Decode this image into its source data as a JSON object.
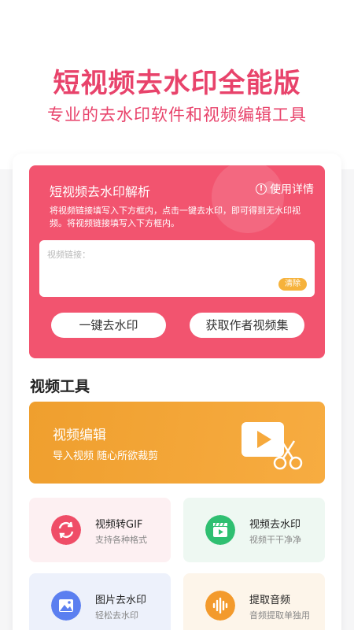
{
  "hero": {
    "title": "短视频去水印全能版",
    "subtitle": "专业的去水印软件和视频编辑工具"
  },
  "parse": {
    "title": "短视频去水印解析",
    "help_label": "使用详情",
    "description": "将视频链接填写入下方框内，点击一键去水印，即可得到无水印视频。将视频链接填写入下方框内。",
    "input_placeholder": "视频链接：",
    "clear_label": "清除",
    "remove_watermark_label": "一键去水印",
    "author_videos_label": "获取作者视频集"
  },
  "tools_section": {
    "title": "视频工具"
  },
  "editor_banner": {
    "title": "视频编辑",
    "subtitle": "导入视频  随心所欲裁剪"
  },
  "tools": [
    {
      "title": "视频转GIF",
      "subtitle": "支持各种格式",
      "icon": "refresh-icon",
      "color": "#ef4d67"
    },
    {
      "title": "视频去水印",
      "subtitle": "视频干干净净",
      "icon": "clapperboard-icon",
      "color": "#2fbf71"
    },
    {
      "title": "图片去水印",
      "subtitle": "轻松去水印",
      "icon": "image-icon",
      "color": "#5b7ff0"
    },
    {
      "title": "提取音频",
      "subtitle": "音频提取单独用",
      "icon": "audio-wave-icon",
      "color": "#f39a2c"
    }
  ],
  "colors": {
    "brand_pink": "#e8436b",
    "panel_pink": "#f2546f",
    "accent_orange": "#f7ac41",
    "clear_yellow": "#f6b23b"
  }
}
